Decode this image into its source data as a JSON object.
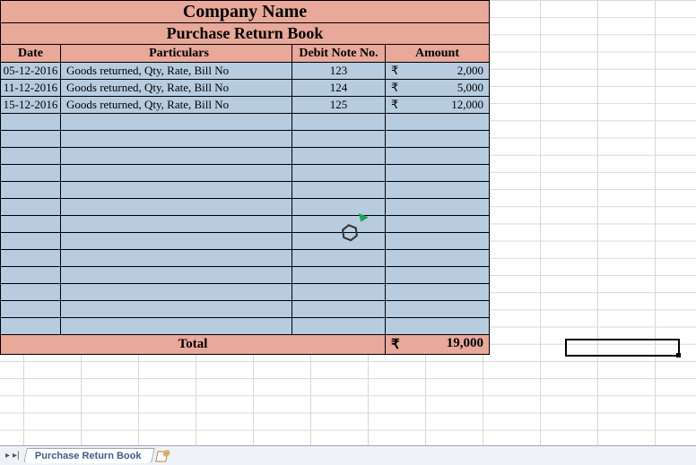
{
  "title": "Company Name",
  "subtitle": "Purchase Return Book",
  "headers": {
    "date": "Date",
    "particulars": "Particulars",
    "debit_note": "Debit Note No.",
    "amount": "Amount"
  },
  "currency": "₹",
  "rows": [
    {
      "date": "05-12-2016",
      "particulars": "Goods returned, Qty, Rate, Bill No",
      "debit_note": "123",
      "amount": "2,000"
    },
    {
      "date": "11-12-2016",
      "particulars": "Goods returned, Qty, Rate, Bill No",
      "debit_note": "124",
      "amount": "5,000"
    },
    {
      "date": "15-12-2016",
      "particulars": "Goods returned, Qty, Rate, Bill No",
      "debit_note": "125",
      "amount": "12,000"
    },
    {
      "date": "",
      "particulars": "",
      "debit_note": "",
      "amount": ""
    },
    {
      "date": "",
      "particulars": "",
      "debit_note": "",
      "amount": ""
    },
    {
      "date": "",
      "particulars": "",
      "debit_note": "",
      "amount": ""
    },
    {
      "date": "",
      "particulars": "",
      "debit_note": "",
      "amount": ""
    },
    {
      "date": "",
      "particulars": "",
      "debit_note": "",
      "amount": ""
    },
    {
      "date": "",
      "particulars": "",
      "debit_note": "",
      "amount": ""
    },
    {
      "date": "",
      "particulars": "",
      "debit_note": "",
      "amount": ""
    },
    {
      "date": "",
      "particulars": "",
      "debit_note": "",
      "amount": ""
    },
    {
      "date": "",
      "particulars": "",
      "debit_note": "",
      "amount": ""
    },
    {
      "date": "",
      "particulars": "",
      "debit_note": "",
      "amount": ""
    },
    {
      "date": "",
      "particulars": "",
      "debit_note": "",
      "amount": ""
    },
    {
      "date": "",
      "particulars": "",
      "debit_note": "",
      "amount": ""
    },
    {
      "date": "",
      "particulars": "",
      "debit_note": "",
      "amount": ""
    }
  ],
  "total_label": "Total",
  "total_amount": "19,000",
  "tab_name": "Purchase Return Book",
  "chart_data": {
    "type": "table",
    "title": "Purchase Return Book",
    "columns": [
      "Date",
      "Particulars",
      "Debit Note No.",
      "Amount"
    ],
    "rows": [
      [
        "05-12-2016",
        "Goods returned, Qty, Rate, Bill No",
        123,
        2000
      ],
      [
        "11-12-2016",
        "Goods returned, Qty, Rate, Bill No",
        124,
        5000
      ],
      [
        "15-12-2016",
        "Goods returned, Qty, Rate, Bill No",
        125,
        12000
      ]
    ],
    "total": 19000,
    "currency": "₹"
  }
}
